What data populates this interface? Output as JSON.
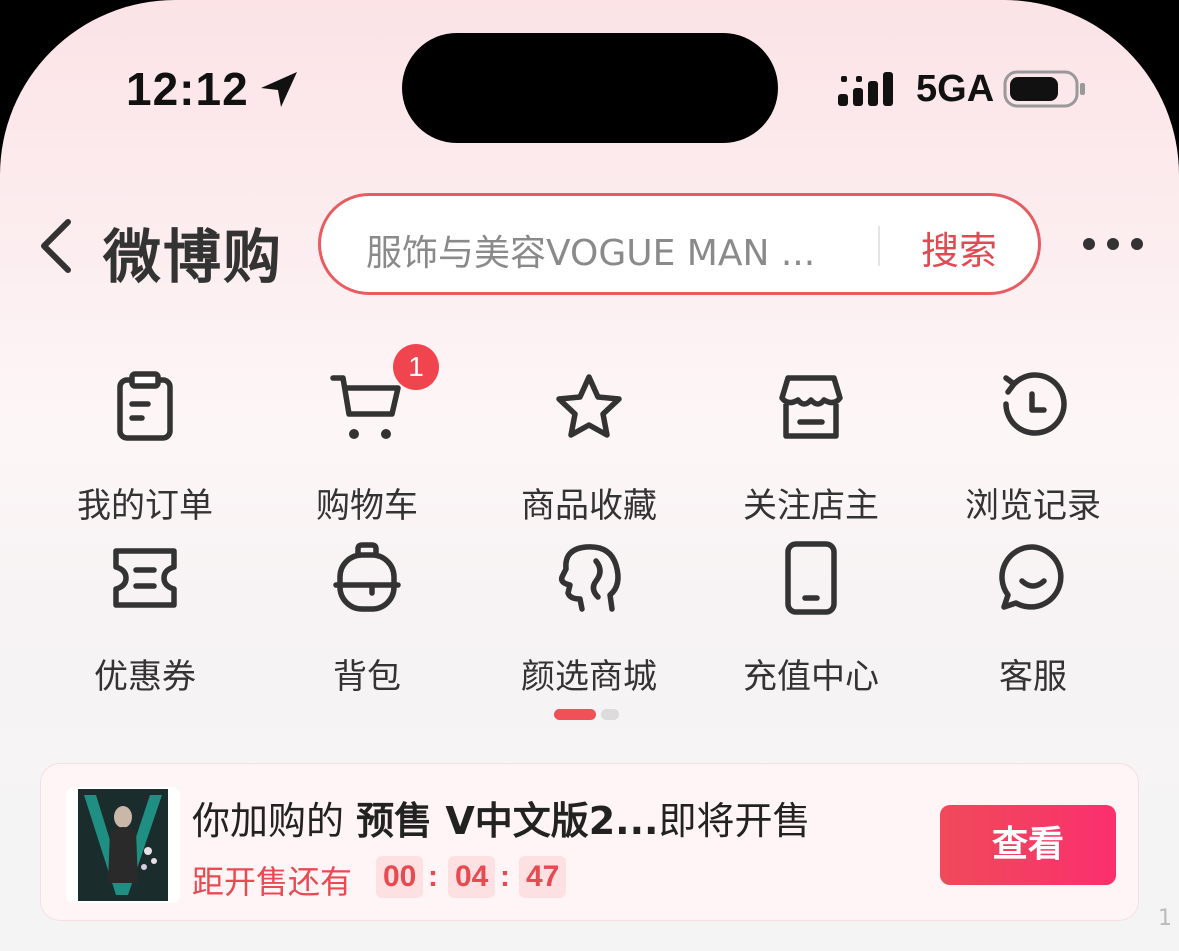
{
  "status_bar": {
    "time": "12:12",
    "network": "5GA"
  },
  "header": {
    "brand": "微博购",
    "search_placeholder": "服饰与美容VOGUE MAN ...",
    "search_button": "搜索"
  },
  "grid": {
    "items": [
      {
        "label": "我的订单",
        "icon": "order-clipboard-icon"
      },
      {
        "label": "购物车",
        "icon": "cart-icon",
        "badge": "1"
      },
      {
        "label": "商品收藏",
        "icon": "star-icon"
      },
      {
        "label": "关注店主",
        "icon": "store-icon"
      },
      {
        "label": "浏览记录",
        "icon": "history-icon"
      },
      {
        "label": "优惠券",
        "icon": "coupon-icon"
      },
      {
        "label": "背包",
        "icon": "backpack-icon"
      },
      {
        "label": "颜选商城",
        "icon": "face-profile-icon"
      },
      {
        "label": "充值中心",
        "icon": "phone-icon"
      },
      {
        "label": "客服",
        "icon": "chat-bubble-icon"
      }
    ],
    "page_indicator": {
      "current": 1,
      "total": 2
    }
  },
  "notice_card": {
    "title_prefix": "你加购的 ",
    "title_bold": "预售 V中文版2...",
    "title_suffix": "即将开售",
    "countdown_label": "距开售还有",
    "hours": "00",
    "minutes": "04",
    "seconds": "47",
    "separator": ":",
    "button": "查看"
  },
  "corner_mark": "1",
  "colors": {
    "accent": "#e85b61",
    "badge": "#f0454f",
    "button_gradient": [
      "#ef4a5a",
      "#fb2f6e"
    ]
  }
}
